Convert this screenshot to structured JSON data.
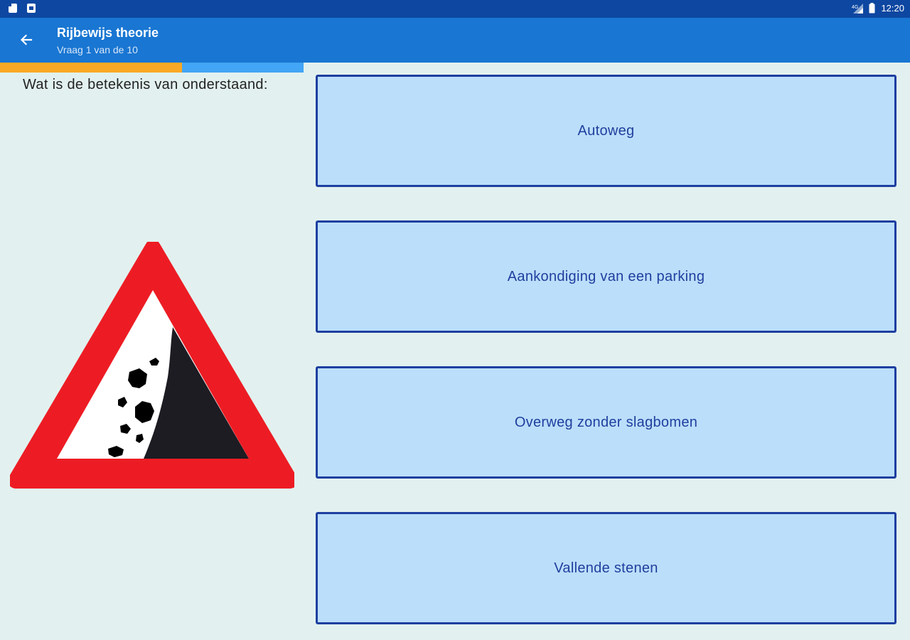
{
  "status_bar": {
    "time": "12:20",
    "left_icons": [
      "document-icon",
      "image-icon"
    ],
    "right_icons": [
      "signal-icon",
      "battery-icon"
    ]
  },
  "app_bar": {
    "title": "Rijbewijs theorie",
    "subtitle": "Vraag 1 van de 10",
    "back_icon": "arrow-left-icon"
  },
  "progress": {
    "fraction": 0.6
  },
  "question": {
    "text": "Wat is de betekenis van onderstaand:",
    "image": "falling-rocks-warning-sign"
  },
  "answers": [
    {
      "label": "Autoweg"
    },
    {
      "label": "Aankondiging van een parking"
    },
    {
      "label": "Overweg zonder slagbomen"
    },
    {
      "label": "Vallende stenen"
    }
  ],
  "colors": {
    "status_bar": "#0d47a1",
    "app_bar": "#1976d2",
    "background": "#e2f1ef",
    "progress_done": "#f9a825",
    "progress_track": "#42a5f5",
    "answer_fill": "#bbdefb",
    "answer_border": "#1e3fa0",
    "sign_red": "#ed1c24"
  }
}
